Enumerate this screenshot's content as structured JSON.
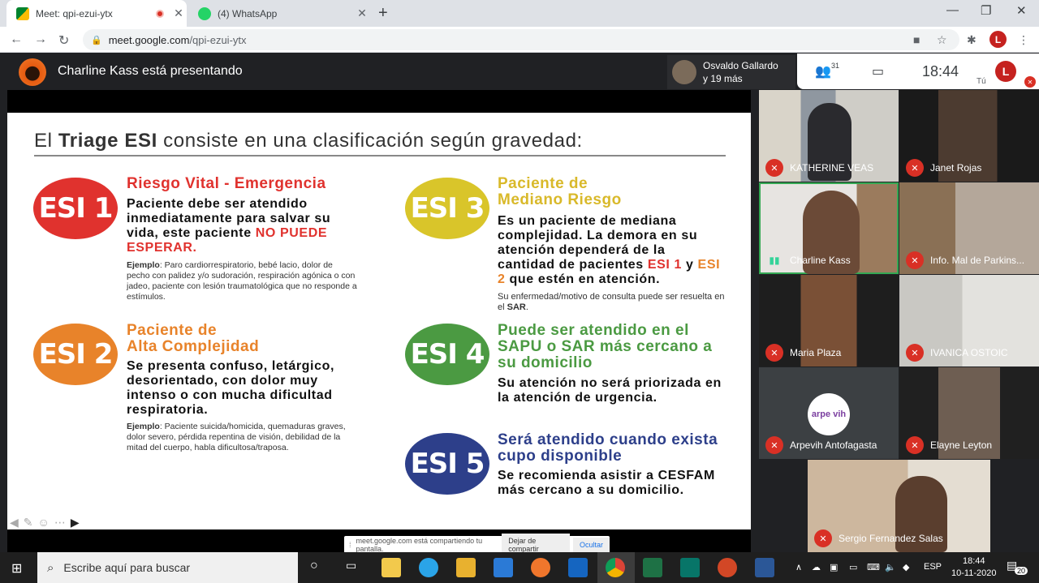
{
  "browser": {
    "tabs": [
      {
        "title": "Meet: qpi-ezui-ytx",
        "active": true
      },
      {
        "title": "(4) WhatsApp",
        "active": false
      }
    ],
    "url": "meet.google.com/qpi-ezui-ytx",
    "url_host": "meet.google.com",
    "url_path": "/qpi-ezui-ytx",
    "profile_initial": "L"
  },
  "meet": {
    "presenter_label": "Charline Kass está presentando",
    "active_speaker": {
      "line1": "Osvaldo Gallardo",
      "line2": "y 19 más"
    },
    "participant_count": "31",
    "clock": "18:44",
    "self_label": "Tú",
    "self_initial": "L",
    "sharing_bar": {
      "message": "meet.google.com está compartiendo tu pantalla.",
      "stop": "Dejar de compartir",
      "hide": "Ocultar"
    }
  },
  "slide": {
    "heading_pre": "El ",
    "heading_bold": "Triage ESI",
    "heading_post": " consiste en una clasificación según gravedad:",
    "esi1": {
      "badge": "ESI 1",
      "color": "#e0322e",
      "title": "Riesgo Vital - Emergencia",
      "body": "Paciente debe ser atendido inmediatamente para salvar su vida, este paciente",
      "body_emph": "NO PUEDE ESPERAR.",
      "example_label": "Ejemplo",
      "example": ": Paro cardiorrespiratorio, bebé lacio, dolor de pecho con palidez y/o sudoración, respiración agónica o con jadeo, paciente con lesión traumatológica que no responde a estímulos."
    },
    "esi2": {
      "badge": "ESI 2",
      "color": "#e8832a",
      "title_l1": "Paciente de",
      "title_l2": "Alta Complejidad",
      "body": "Se presenta confuso, letárgico, desorientado, con dolor muy intenso o con mucha dificultad respiratoria.",
      "example_label": "Ejemplo",
      "example": ": Paciente suicida/homicida, quemaduras graves, dolor severo, pérdida repentina de visión, debilidad de la mitad del cuerpo, habla dificultosa/traposa."
    },
    "esi3": {
      "badge": "ESI 3",
      "color": "#d9c52a",
      "title_l1": "Paciente de",
      "title_l2": "Mediano Riesgo",
      "body_a": "Es un paciente de mediana complejidad. La demora en su atención dependerá de la cantidad de pacientes",
      "body_b": "ESI 1",
      "body_c": " y",
      "body_d": "ESI 2",
      "body_e": " que estén en atención.",
      "note": "Su enfermedad/motivo de consulta puede ser resuelta en el",
      "note_bold": "SAR",
      "note_end": "."
    },
    "esi4": {
      "badge": "ESI 4",
      "color": "#4b9a42",
      "title": "Puede ser atendido en el SAPU o SAR más cercano a su domicilio",
      "body": "Su atención no será priorizada en la atención de urgencia."
    },
    "esi5": {
      "badge": "ESI 5",
      "color": "#2d3f8a",
      "title": "Será atendido cuando exista cupo disponible",
      "body": "Se recomienda asistir a CESFAM más cercano a su domicilio."
    }
  },
  "participants": [
    {
      "name": "KATHERINE VEAS",
      "muted": true
    },
    {
      "name": "Janet Rojas",
      "muted": true
    },
    {
      "name": "Charline Kass",
      "muted": false
    },
    {
      "name": "Info. Mal de Parkins...",
      "muted": true
    },
    {
      "name": "Maria Plaza",
      "muted": true
    },
    {
      "name": "IVANICA OSTOIC",
      "muted": true
    },
    {
      "name": "Arpevih Antofagasta",
      "muted": true,
      "logo_text": "arpe vih"
    },
    {
      "name": "Elayne Leyton",
      "muted": true
    },
    {
      "name": "Sergio Fernandez Salas",
      "muted": true
    }
  ],
  "taskbar": {
    "search_placeholder": "Escribe aquí para buscar",
    "lang": "ESP",
    "time": "18:44",
    "date": "10-11-2020",
    "notifications": "20"
  }
}
